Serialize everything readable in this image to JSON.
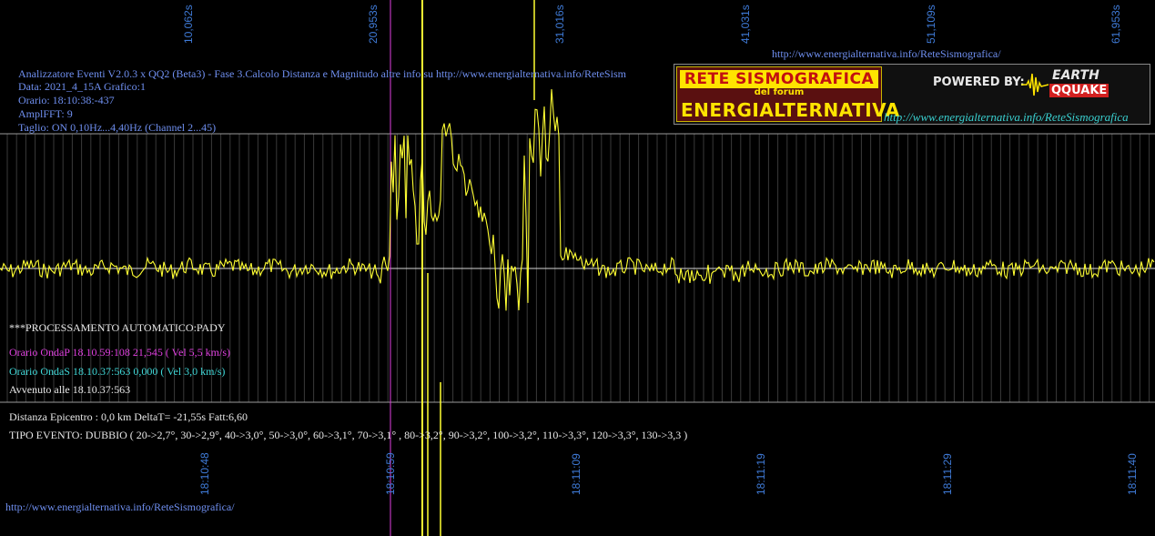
{
  "header": {
    "line1": "Analizzatore Eventi V2.0.3 x QQ2 (Beta3) - Fase 3.Calcolo Distanza e Magnitudo altre info su http://www.energialternativa.info/ReteSism",
    "line2": "Data: 2021_4_15A Grafico:1",
    "line3": "Orario: 18:10:38:-437",
    "line4": "AmplFFT: 9",
    "line5": "Taglio: ON 0,10Hz...4,40Hz       (Channel 2...45)"
  },
  "top_url": "http://www.energialternativa.info/ReteSismografica/",
  "bottom_url": "http://www.energialternativa.info/ReteSismografica/",
  "second_labels": [
    "10,062s",
    "20,953s",
    "31,016s",
    "41,031s",
    "51,109s",
    "61,953s"
  ],
  "time_labels": [
    "18:10:48",
    "18:10:59",
    "18:11:09",
    "18:11:19",
    "18:11:29",
    "18:11:40"
  ],
  "processing": {
    "title": "***PROCESSAMENTO AUTOMATICO:PADY",
    "p_wave": "Orario OndaP 18.10.59:108  21,545 ( Vel 5,5 km/s)",
    "s_wave": "Orario OndaS 18.10.37:563  0,000 ( Vel 3,0 km/s)",
    "occurred": "Avvenuto alle 18.10.37:563",
    "distance": "Distanza Epicentro : 0,0 km DeltaT= -21,55s  Fatt:6,60",
    "event_type": "TIPO EVENTO: DUBBIO ( 20->2,7°, 30->2,9°, 40->3,0°, 50->3,0°, 60->3,1°, 70->3,1° , 80->3,2°, 90->3,2°, 100->3,2°, 110->3,3°, 120->3,3°, 130->3,3 )"
  },
  "logo": {
    "top": "RETE SISMOGRAFICA",
    "middle": "del forum",
    "bottom": "ENERGIALTERNATIVA",
    "powered": "POWERED BY:",
    "earth": "EARTH",
    "qquake": "QQUAKE",
    "url": "http://www.energialternativa.info/ReteSismografica"
  },
  "colors": {
    "background": "#000000",
    "trace": "#ffff33",
    "grid": "#4a4a4a",
    "baseline": "#d8d8d8",
    "p_wave": "#e040e0",
    "s_wave": "#40d8d8",
    "labels": "#3f7bd8"
  }
}
